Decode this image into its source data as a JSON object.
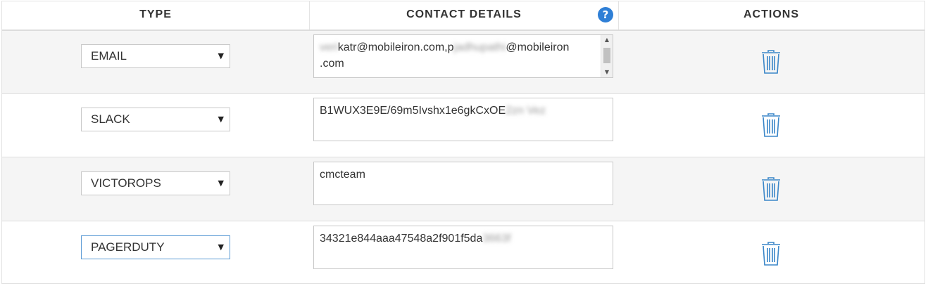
{
  "header": {
    "type": "TYPE",
    "contact_details": "CONTACT DETAILS",
    "actions": "ACTIONS",
    "help_icon": "?"
  },
  "colors": {
    "accent": "#2f7fd6",
    "trash_icon": "#3a86c8",
    "row_shade": "#f5f5f5"
  },
  "icons": {
    "help": "help-icon",
    "delete": "trash-icon",
    "dropdown": "chevron-down-icon"
  },
  "rows": [
    {
      "type": "EMAIL",
      "contact": {
        "p1": "veri",
        "p2": "katr@mobileiron.com,p",
        "p3": "jadhupathi",
        "p4": "@mobileiron",
        "p5": ".com"
      }
    },
    {
      "type": "SLACK",
      "contact": {
        "p1": "B1WUX3E9E/69m5Ivshx1e6gkCxOE",
        "p2": "2zn Vez"
      }
    },
    {
      "type": "VICTOROPS",
      "contact": {
        "p1": "cmcteam"
      }
    },
    {
      "type": "PAGERDUTY",
      "contact": {
        "p1": "34321e844aaa47548a2f901f5da",
        "p2": "3663f"
      }
    }
  ]
}
